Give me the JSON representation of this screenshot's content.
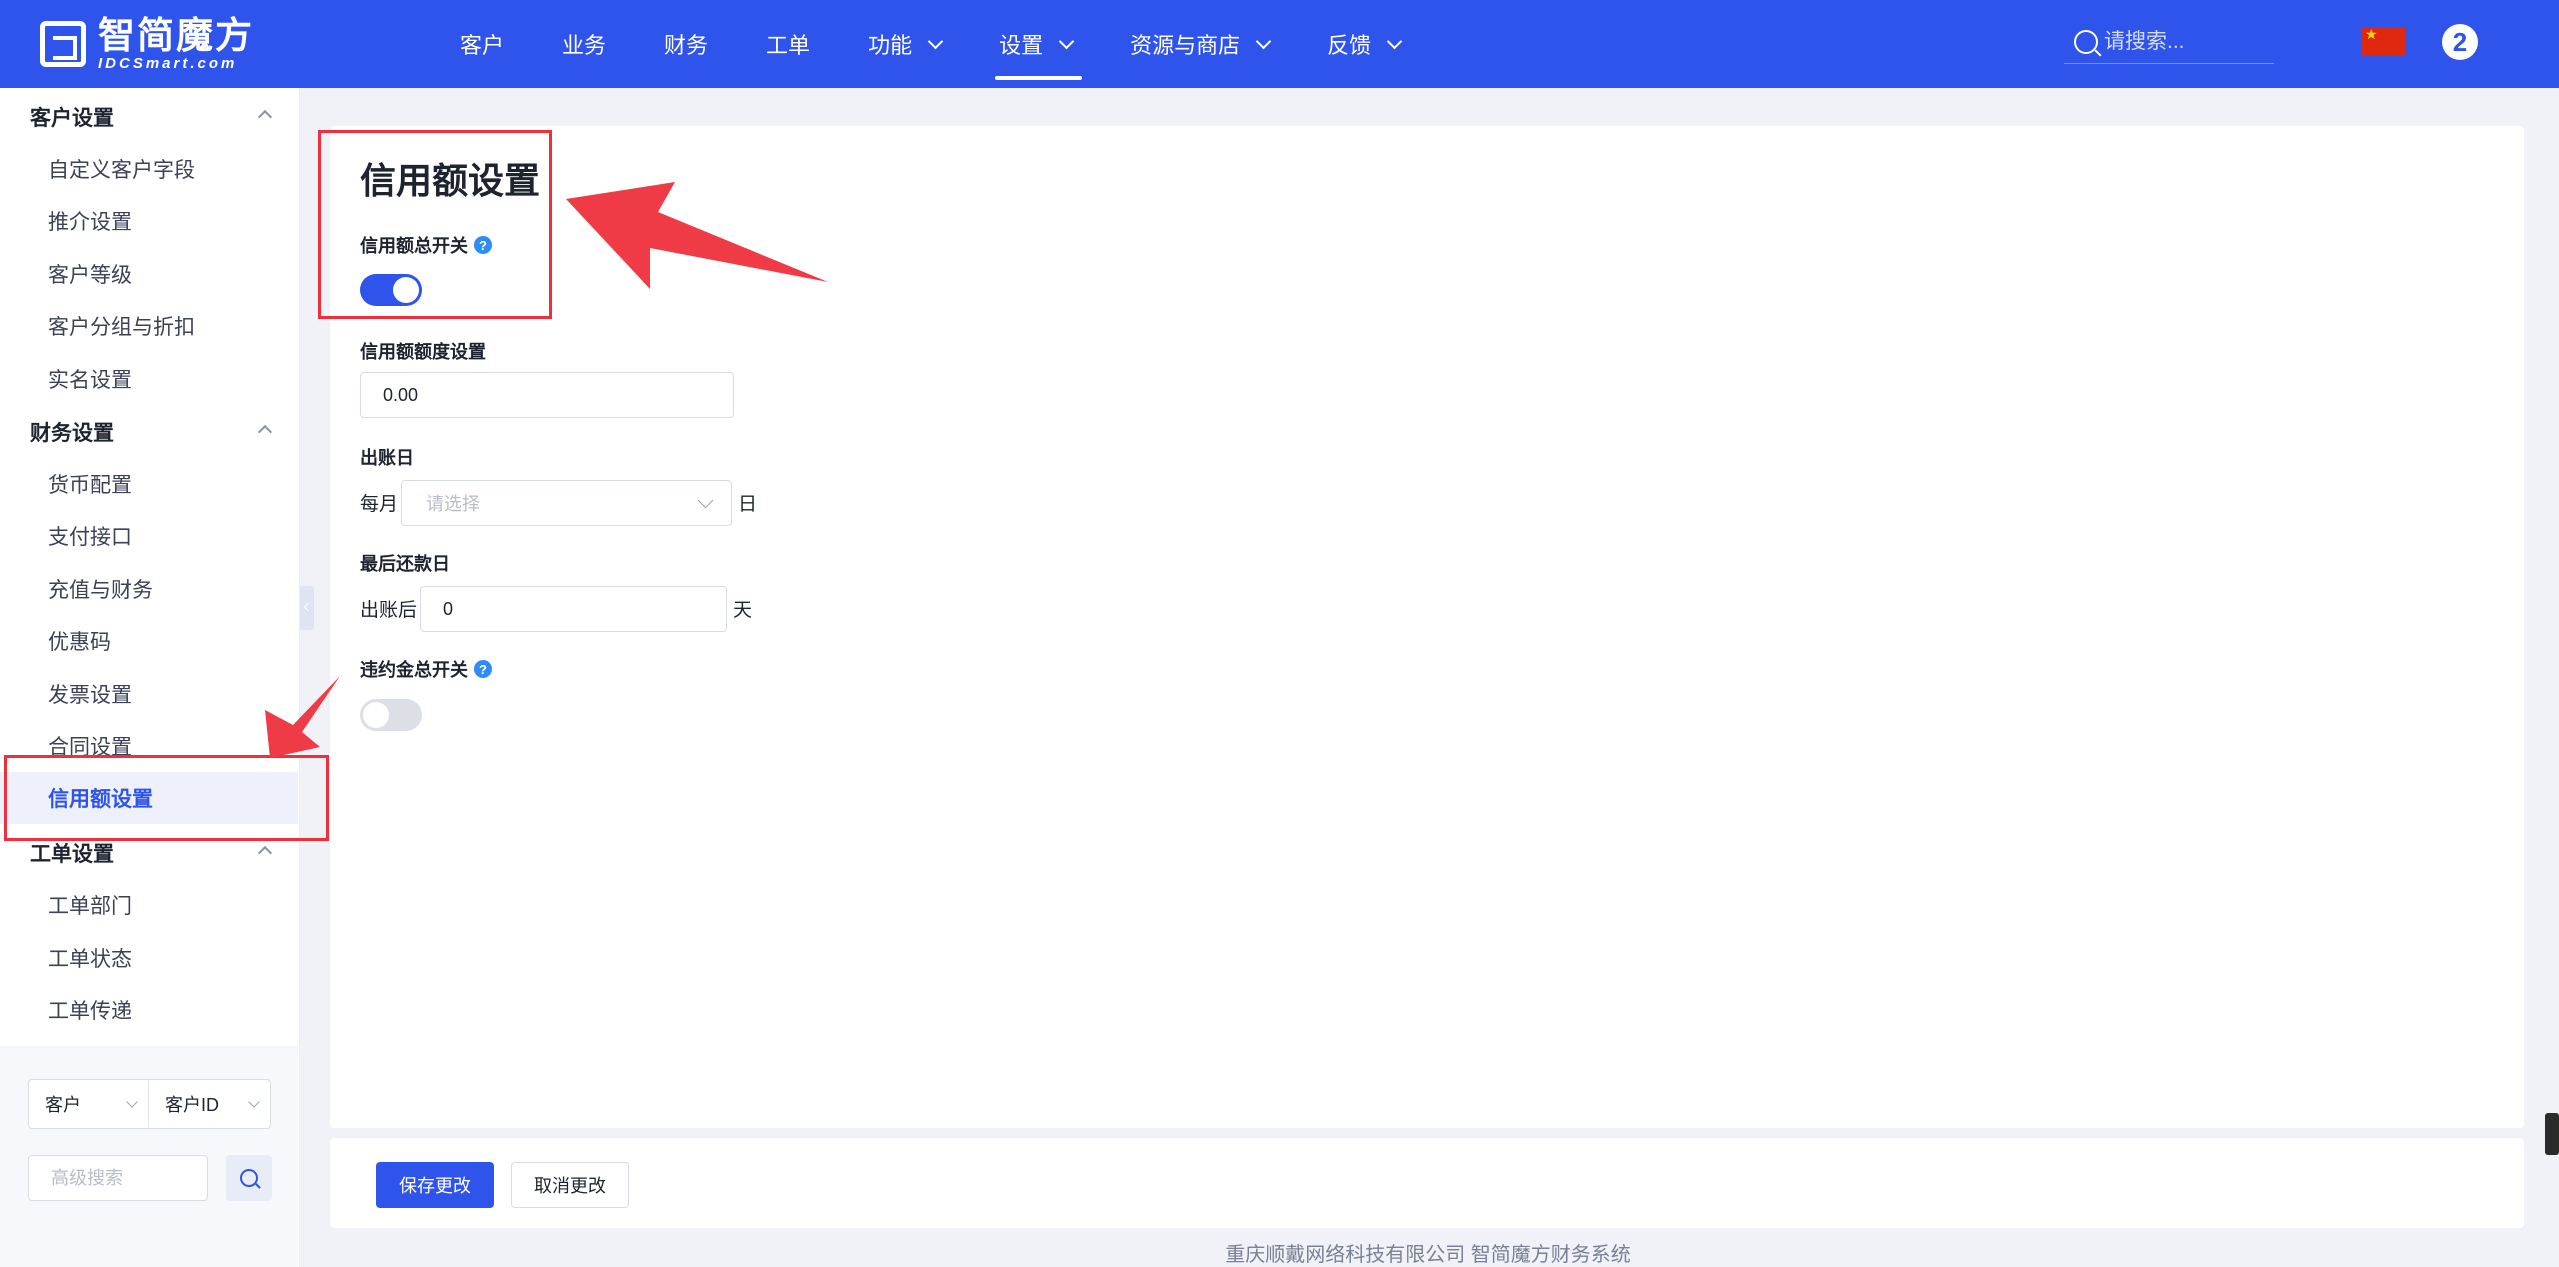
{
  "brand": {
    "name_cn": "智简魔方",
    "name_en": "IDCSmart.com"
  },
  "nav": {
    "items": [
      {
        "label": "客户",
        "dropdown": false,
        "active": false
      },
      {
        "label": "业务",
        "dropdown": false,
        "active": false
      },
      {
        "label": "财务",
        "dropdown": false,
        "active": false
      },
      {
        "label": "工单",
        "dropdown": false,
        "active": false
      },
      {
        "label": "功能",
        "dropdown": true,
        "active": false
      },
      {
        "label": "设置",
        "dropdown": true,
        "active": true
      },
      {
        "label": "资源与商店",
        "dropdown": true,
        "active": false
      },
      {
        "label": "反馈",
        "dropdown": true,
        "active": false
      }
    ],
    "search_placeholder": "请搜索...",
    "avatar_text": "2"
  },
  "sidebar": {
    "groups": [
      {
        "title": "客户设置",
        "items": [
          "自定义客户字段",
          "推介设置",
          "客户等级",
          "客户分组与折扣",
          "实名设置"
        ]
      },
      {
        "title": "财务设置",
        "items": [
          "货币配置",
          "支付接口",
          "充值与财务",
          "优惠码",
          "发票设置",
          "合同设置",
          "信用额设置"
        ]
      },
      {
        "title": "工单设置",
        "items": [
          "工单部门",
          "工单状态",
          "工单传递"
        ]
      }
    ],
    "active_item": "信用额设置",
    "filter": {
      "type_value": "客户",
      "field_value": "客户ID"
    },
    "advanced_search_placeholder": "高级搜索"
  },
  "form": {
    "title": "信用额设置",
    "credit_switch": {
      "label": "信用额总开关",
      "on": true
    },
    "credit_limit": {
      "label": "信用额额度设置",
      "value": "0.00"
    },
    "bill_day": {
      "label": "出账日",
      "prefix": "每月",
      "placeholder": "请选择",
      "suffix": "日"
    },
    "last_repay_day": {
      "label": "最后还款日",
      "prefix": "出账后",
      "value": "0",
      "suffix": "天"
    },
    "penalty_switch": {
      "label": "违约金总开关",
      "on": false
    },
    "save_label": "保存更改",
    "cancel_label": "取消更改"
  },
  "footer": {
    "copyright": "重庆顺戴网络科技有限公司 智简魔方财务系统"
  },
  "colors": {
    "primary": "#2f54eb",
    "annotation": "#ef2f3c",
    "help": "#2f8cf5"
  }
}
